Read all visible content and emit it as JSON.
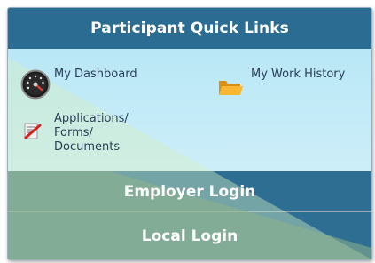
{
  "widget": {
    "title": "Participant Quick Links",
    "links": [
      {
        "label": "My Dashboard",
        "icon": "dashboard-gauge-icon"
      },
      {
        "label": "My Work History",
        "icon": "folder-icon"
      },
      {
        "label": "Applications/\nForms/\nDocuments",
        "icon": "document-edit-icon"
      }
    ],
    "employer_login": "Employer Login",
    "local_login": "Local Login"
  },
  "colors": {
    "header": "#2b6d92",
    "links_bg": "#b9e7f6",
    "overlay": "#d7efc0",
    "bars": "#2e6e92",
    "link_text": "#2a3f57"
  }
}
